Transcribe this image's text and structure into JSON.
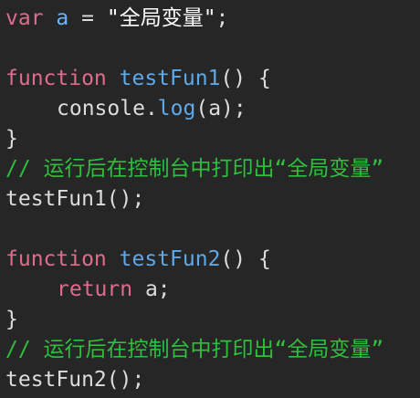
{
  "code": {
    "line1": {
      "keyword": "var",
      "name": "a",
      "op": "=",
      "string": "\"全局变量\"",
      "end": ";"
    },
    "line3": {
      "keyword": "function",
      "name": "testFun1",
      "tail": "() {"
    },
    "line4": {
      "object": "console",
      "dot": ".",
      "method": "log",
      "args": "(a);"
    },
    "line5": {
      "text": "}"
    },
    "line6": {
      "comment": "// 运行后在控制台中打印出“全局变量”"
    },
    "line7": {
      "call": "testFun1();"
    },
    "line9": {
      "keyword": "function",
      "name": "testFun2",
      "tail": "() {"
    },
    "line10": {
      "keyword": "return",
      "value": "a;"
    },
    "line11": {
      "text": "}"
    },
    "line12": {
      "comment": "// 运行后在控制台中打印出“全局变量”"
    },
    "line13": {
      "call": "testFun2();"
    }
  },
  "colors": {
    "background": "#262626",
    "keyword": "#e06c8c",
    "function_name": "#5da9e9",
    "comment": "#2fbf3f",
    "text": "#dcdcdc"
  }
}
